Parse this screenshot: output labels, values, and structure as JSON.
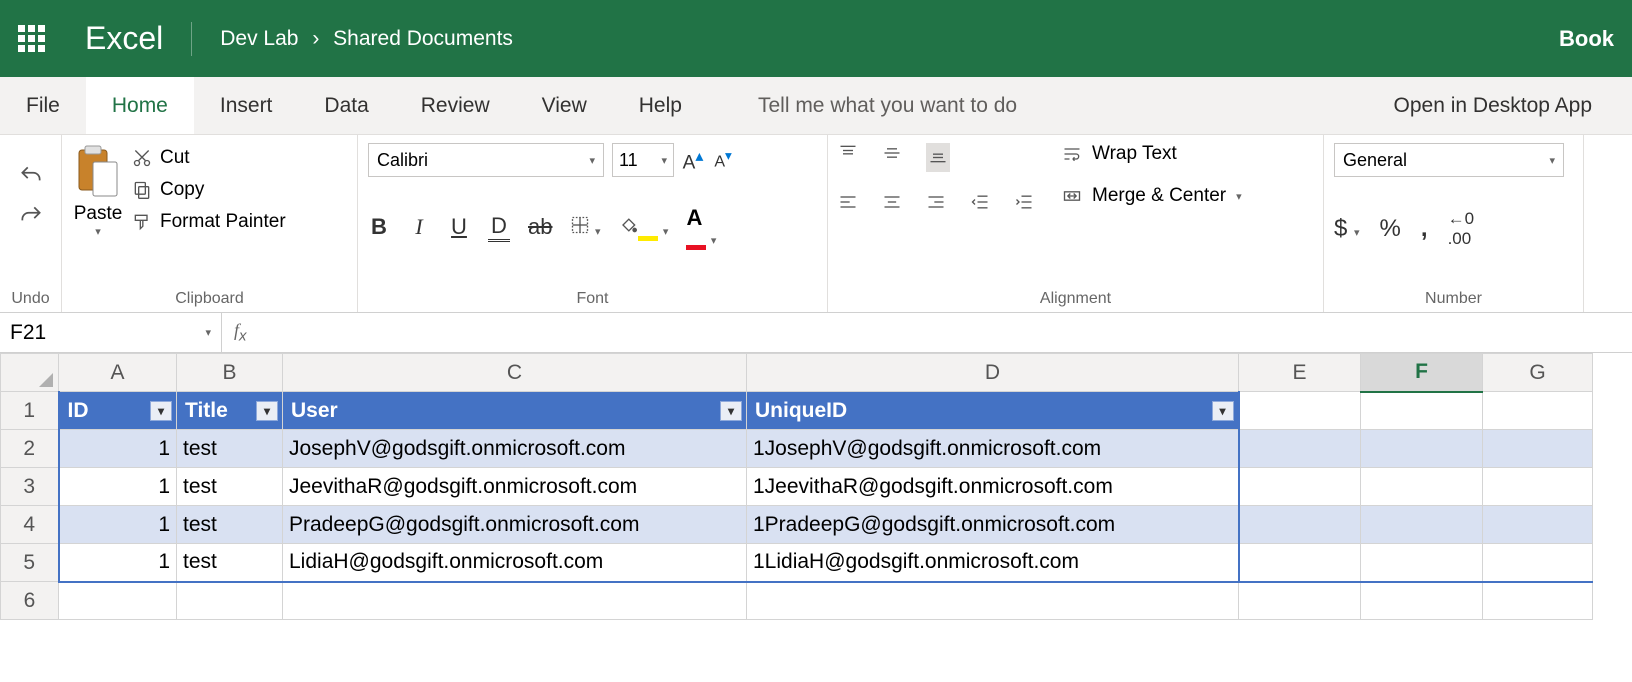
{
  "header": {
    "app_name": "Excel",
    "breadcrumb_parent": "Dev Lab",
    "breadcrumb_child": "Shared Documents",
    "document_name": "Book"
  },
  "ribbon": {
    "tabs": {
      "file": "File",
      "home": "Home",
      "insert": "Insert",
      "data": "Data",
      "review": "Review",
      "view": "View",
      "help": "Help"
    },
    "tellme_placeholder": "Tell me what you want to do",
    "open_desktop": "Open in Desktop App",
    "groups": {
      "undo": "Undo",
      "clipboard": {
        "label": "Clipboard",
        "paste": "Paste",
        "cut": "Cut",
        "copy": "Copy",
        "format_painter": "Format Painter"
      },
      "font": {
        "label": "Font",
        "name": "Calibri",
        "size": "11"
      },
      "alignment": {
        "label": "Alignment",
        "wrap": "Wrap Text",
        "merge": "Merge & Center"
      },
      "number": {
        "label": "Number",
        "format": "General"
      }
    }
  },
  "formula_bar": {
    "cell_ref": "F21",
    "formula": ""
  },
  "columns": {
    "A": "A",
    "B": "B",
    "C": "C",
    "D": "D",
    "E": "E",
    "F": "F",
    "G": "G"
  },
  "col_widths": {
    "A": 118,
    "B": 106,
    "C": 464,
    "D": 492,
    "E": 122,
    "F": 122,
    "G": 110
  },
  "table": {
    "headers": {
      "id": "ID",
      "title": "Title",
      "user": "User",
      "uniqueid": "UniqueID"
    },
    "rows": [
      {
        "id": "1",
        "title": "test",
        "user": "JosephV@godsgift.onmicrosoft.com",
        "uniqueid": "1JosephV@godsgift.onmicrosoft.com"
      },
      {
        "id": "1",
        "title": "test",
        "user": "JeevithaR@godsgift.onmicrosoft.com",
        "uniqueid": "1JeevithaR@godsgift.onmicrosoft.com"
      },
      {
        "id": "1",
        "title": "test",
        "user": "PradeepG@godsgift.onmicrosoft.com",
        "uniqueid": "1PradeepG@godsgift.onmicrosoft.com"
      },
      {
        "id": "1",
        "title": "test",
        "user": "LidiaH@godsgift.onmicrosoft.com",
        "uniqueid": "1LidiaH@godsgift.onmicrosoft.com"
      }
    ]
  }
}
